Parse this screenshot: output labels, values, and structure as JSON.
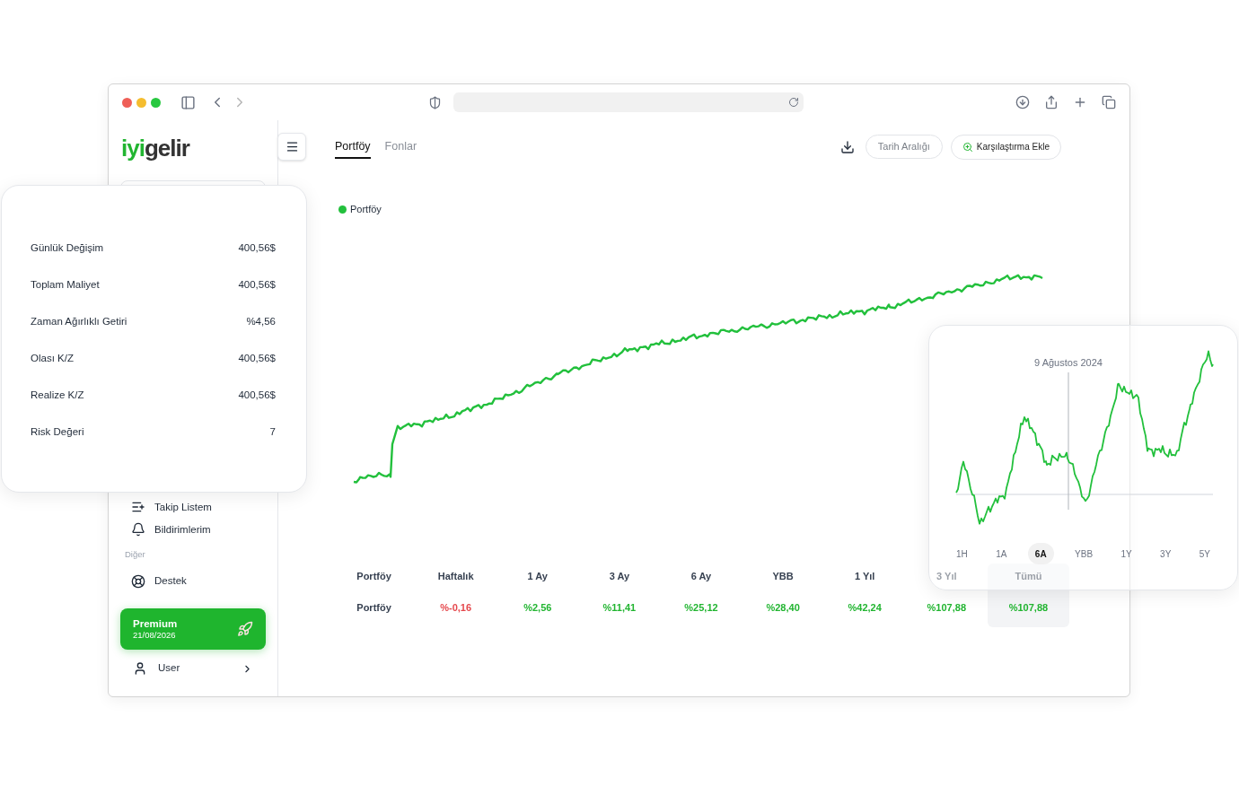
{
  "sidebar": {
    "logo_accent": "iyi",
    "logo_rest": "gelir",
    "items": [
      {
        "label": "Takip Listem",
        "kind": "watchlist"
      },
      {
        "label": "Bildirimlerim",
        "kind": "notifications"
      }
    ],
    "section": "Diğer",
    "other_items": [
      {
        "label": "Destek",
        "kind": "support"
      }
    ],
    "premium": {
      "title": "Premium",
      "date": "21/08/2026"
    },
    "user": {
      "name": "User"
    }
  },
  "tabs": [
    {
      "label": "Portföy",
      "selected": true
    },
    {
      "label": "Fonlar",
      "selected": false
    }
  ],
  "actions": {
    "date_range": "Tarih Aralığı",
    "compare": "Karşılaştırma Ekle"
  },
  "legend": {
    "label": "Portföy",
    "color": "#22c03c"
  },
  "returns_table": {
    "columns": [
      {
        "label": "Portföy",
        "selected": false
      },
      {
        "label": "Haftalık",
        "selected": false
      },
      {
        "label": "1 Ay",
        "selected": false
      },
      {
        "label": "3 Ay",
        "selected": false
      },
      {
        "label": "6 Ay",
        "selected": false
      },
      {
        "label": "YBB",
        "selected": false
      },
      {
        "label": "1 Yıl",
        "selected": false
      },
      {
        "label": "3 Yıl",
        "selected": false
      },
      {
        "label": "Tümü",
        "selected": true
      }
    ],
    "rows": [
      {
        "cells": [
          {
            "value": "Portföy",
            "kind": "label"
          },
          {
            "value": "%-0,16",
            "kind": "negative"
          },
          {
            "value": "%2,56",
            "kind": "positive"
          },
          {
            "value": "%11,41",
            "kind": "positive"
          },
          {
            "value": "%25,12",
            "kind": "positive"
          },
          {
            "value": "%28,40",
            "kind": "positive"
          },
          {
            "value": "%42,24",
            "kind": "positive"
          },
          {
            "value": "%107,88",
            "kind": "positive"
          },
          {
            "value": "%107,88",
            "kind": "positive"
          }
        ]
      }
    ]
  },
  "stats_card": {
    "rows": [
      {
        "label": "Günlük Değişim",
        "value": "400,56$"
      },
      {
        "label": "Toplam Maliyet",
        "value": "400,56$"
      },
      {
        "label": "Zaman Ağırlıklı Getiri",
        "value": "%4,56"
      },
      {
        "label": "Olası K/Z",
        "value": "400,56$"
      },
      {
        "label": "Realize K/Z",
        "value": "400,56$"
      },
      {
        "label": "Risk Değeri",
        "value": "7"
      }
    ]
  },
  "mini_chart": {
    "tooltip_date": "9 Ağustos 2024",
    "ranges": [
      {
        "label": "1H",
        "selected": false
      },
      {
        "label": "1A",
        "selected": false
      },
      {
        "label": "6A",
        "selected": true
      },
      {
        "label": "YBB",
        "selected": false
      },
      {
        "label": "1Y",
        "selected": false
      },
      {
        "label": "3Y",
        "selected": false
      },
      {
        "label": "5Y",
        "selected": false
      }
    ]
  }
}
